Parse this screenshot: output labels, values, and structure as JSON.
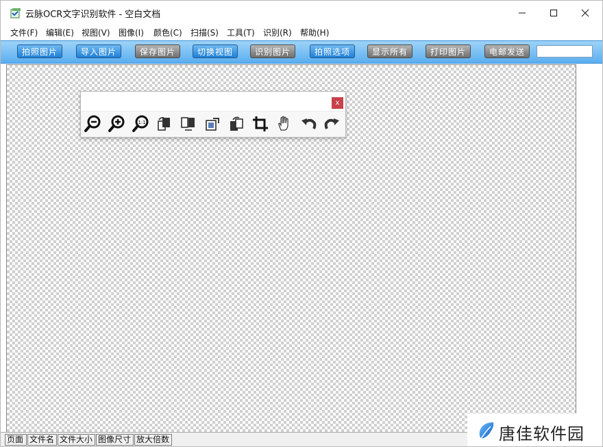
{
  "window": {
    "title": "云脉OCR文字识别软件 - 空白文档",
    "app_icon": "app-icon",
    "controls": [
      "minimize-icon",
      "maximize-icon",
      "close-icon"
    ]
  },
  "menu": [
    {
      "label": "文件(F)"
    },
    {
      "label": "编辑(E)"
    },
    {
      "label": "视图(V)"
    },
    {
      "label": "图像(I)"
    },
    {
      "label": "颜色(C)"
    },
    {
      "label": "扫描(S)"
    },
    {
      "label": "工具(T)"
    },
    {
      "label": "识别(R)"
    },
    {
      "label": "帮助(H)"
    }
  ],
  "toolbar": {
    "buttons": [
      {
        "label": "拍照图片",
        "style": "blue"
      },
      {
        "label": "导入图片",
        "style": "blue"
      },
      {
        "label": "保存图片",
        "style": "gray"
      },
      {
        "label": "切换视图",
        "style": "blue"
      },
      {
        "label": "识别图片",
        "style": "gray"
      },
      {
        "label": "拍照选项",
        "style": "blue"
      },
      {
        "label": "显示所有",
        "style": "gray"
      },
      {
        "label": "打印图片",
        "style": "gray"
      },
      {
        "label": "电邮发送",
        "style": "gray"
      }
    ],
    "search_value": ""
  },
  "image_toolbar": {
    "close_label": "x",
    "tools": [
      "zoom-out-icon",
      "zoom-in-icon",
      "actual-size-icon",
      "rotate-right-icon",
      "flip-icon",
      "deskew-icon",
      "rotate-left-icon",
      "crop-icon",
      "hand-pan-icon",
      "undo-icon",
      "redo-icon"
    ]
  },
  "statusbar": {
    "cells": [
      "页面",
      "文件名",
      "文件大小",
      "图像尺寸",
      "放大倍数"
    ]
  },
  "watermark": {
    "text": "唐佳软件园",
    "logo": "leaf-logo"
  },
  "colors": {
    "toolbar_bg": "#5aaef0",
    "button_blue": "#1f7fd6",
    "button_gray": "#6f6f6f",
    "close_button": "#c9414a"
  }
}
